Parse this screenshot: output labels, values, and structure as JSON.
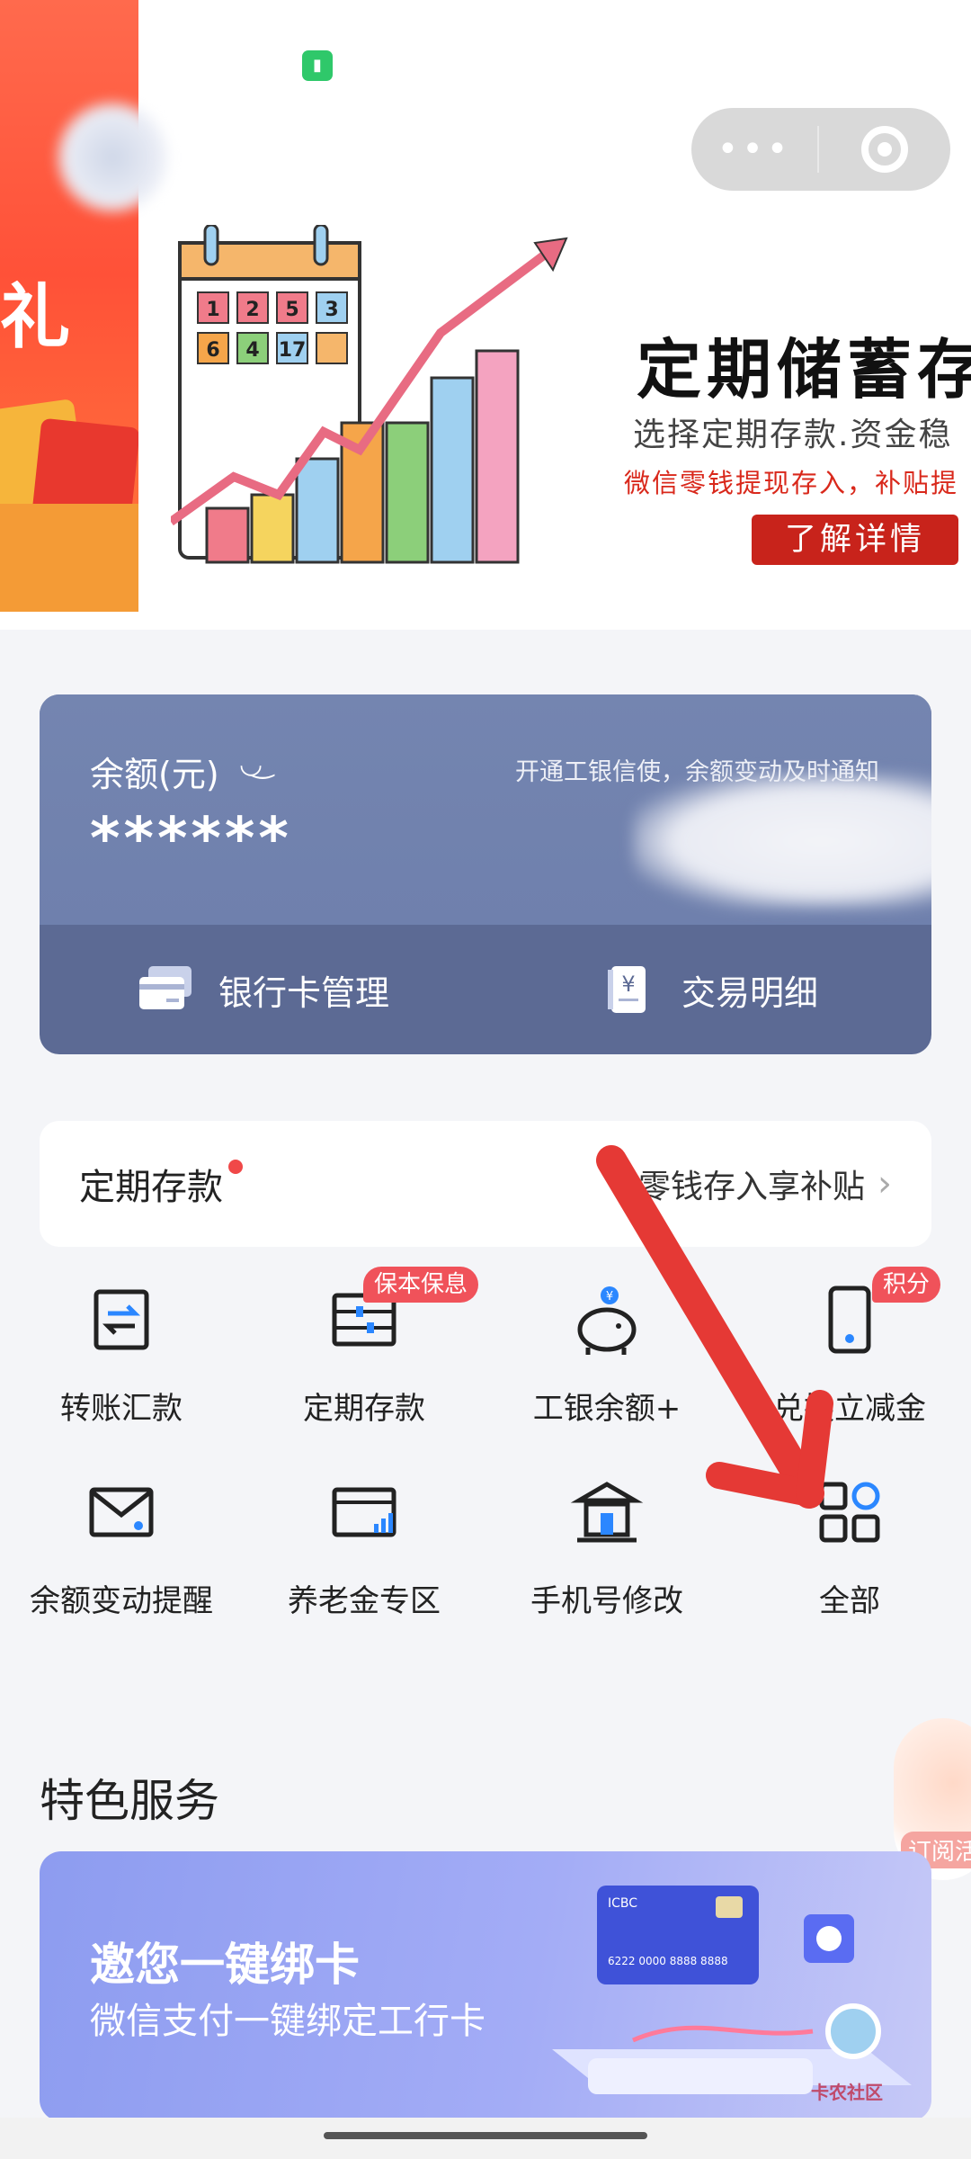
{
  "side_banner": {
    "text": "礼"
  },
  "promo": {
    "title": "定期储蓄存",
    "subtitle": "选择定期存款.资金稳",
    "red_text": "微信零钱提现存入，补贴提",
    "button": "了解详情",
    "calendar_numbers": [
      "1",
      "2",
      "5",
      "3",
      "6",
      "4",
      "17"
    ]
  },
  "balance_card": {
    "label": "余额(元)",
    "notify": "开通工银信使，余额变动及时通知",
    "amount": "******",
    "card_manage": "银行卡管理",
    "transactions": "交易明细"
  },
  "deposit_row": {
    "title": "定期存款",
    "right": "零钱存入享补贴"
  },
  "grid": [
    {
      "label": "转账汇款",
      "icon": "transfer-icon"
    },
    {
      "label": "定期存款",
      "icon": "abacus-icon",
      "tag": "保本保息"
    },
    {
      "label": "工银余额+",
      "icon": "piggy-bank-icon"
    },
    {
      "label": "兑换立减金",
      "icon": "phone-icon",
      "tag": "积分"
    },
    {
      "label": "余额变动提醒",
      "icon": "mail-icon"
    },
    {
      "label": "养老金专区",
      "icon": "card-signal-icon"
    },
    {
      "label": "手机号修改",
      "icon": "bank-icon"
    },
    {
      "label": "全部",
      "icon": "grid-icon"
    }
  ],
  "section_title": "特色服务",
  "float_badge": "订阅活",
  "bind_card": {
    "title": "邀您一键绑卡",
    "subtitle": "微信支付一键绑定工行卡",
    "card_brand": "ICBC",
    "card_number": "6222 0000 8888 8888"
  },
  "watermark": "卡农社区",
  "colors": {
    "accent_red": "#c8231b",
    "card_blue": "#6f80ad",
    "tag_red": "#f0525a",
    "arrow_red": "#e53935"
  }
}
